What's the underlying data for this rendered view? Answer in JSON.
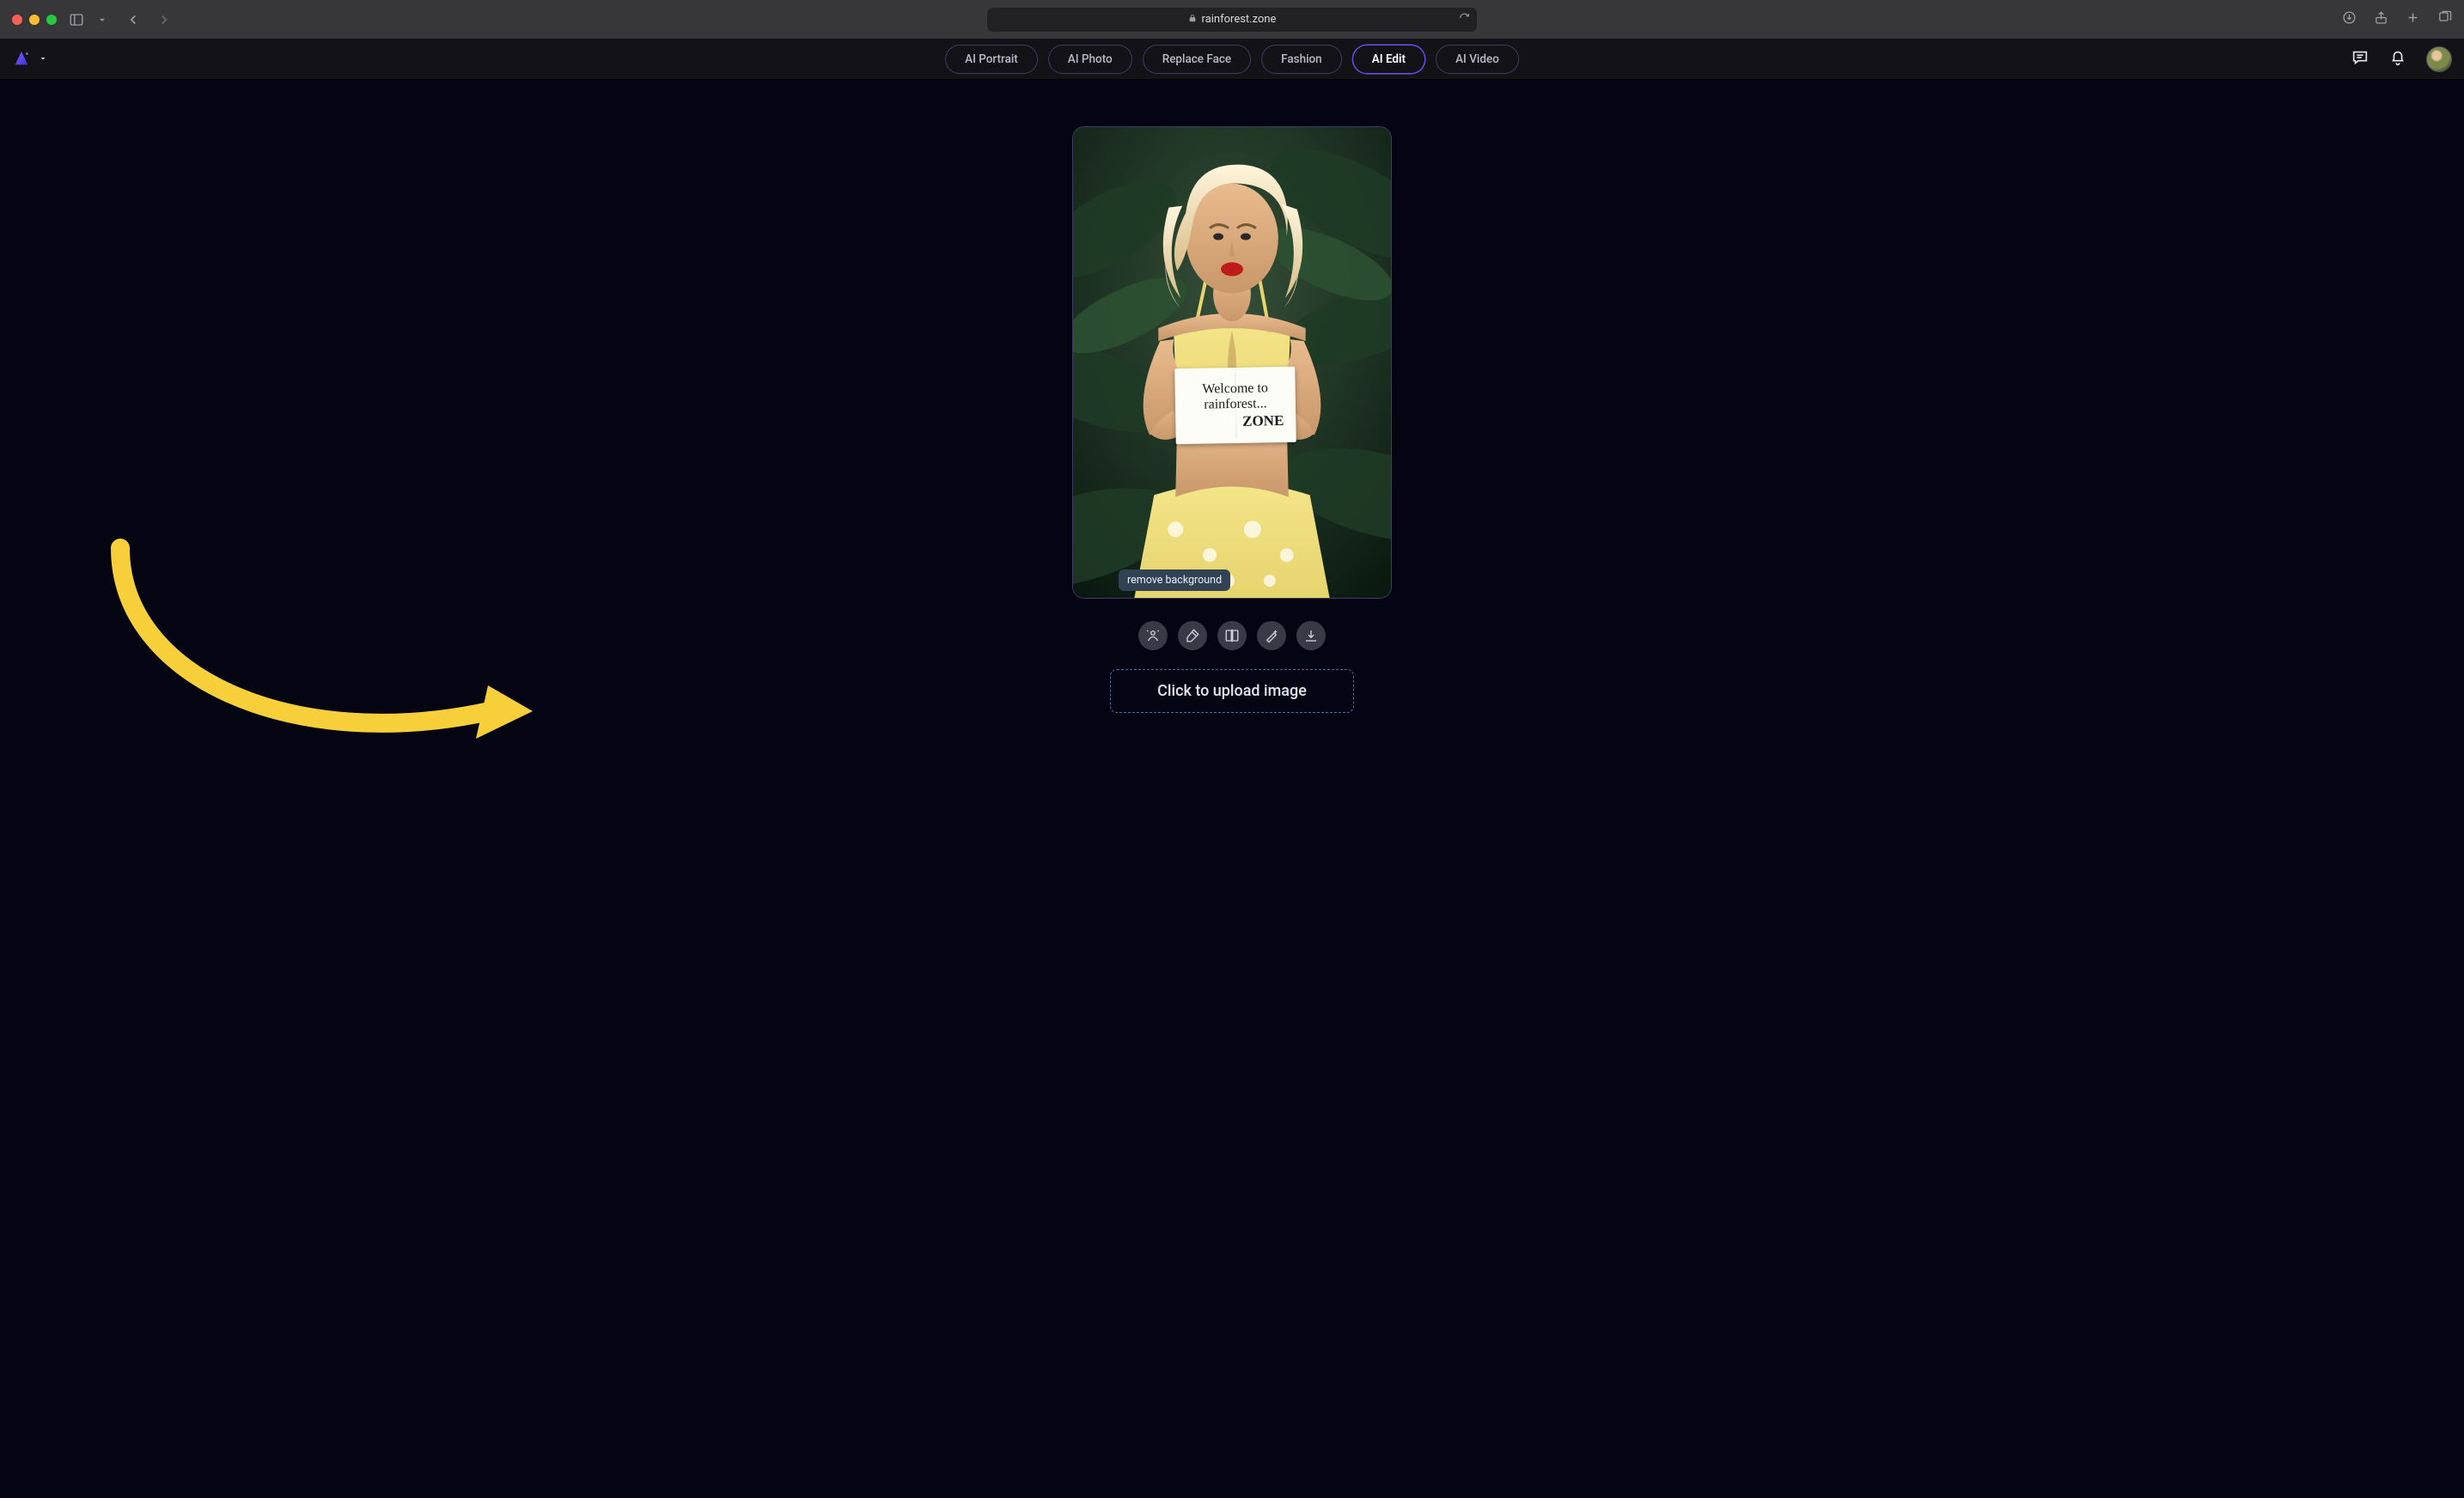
{
  "browser": {
    "url_host": "rainforest.zone"
  },
  "nav": {
    "tabs": [
      {
        "label": "AI Portrait"
      },
      {
        "label": "AI Photo"
      },
      {
        "label": "Replace Face"
      },
      {
        "label": "Fashion"
      },
      {
        "label": "AI Edit",
        "active": true
      },
      {
        "label": "AI Video"
      }
    ]
  },
  "image_sign": {
    "line1": "Welcome to",
    "line2": "rainforest...",
    "line3": "ZONE"
  },
  "tooltip": {
    "remove_bg": "remove background"
  },
  "tools": {
    "remove_bg": "remove-background",
    "erase": "erase",
    "compare": "compare",
    "magic": "magic-enhance",
    "download": "download"
  },
  "upload": {
    "label": "Click to upload image"
  }
}
